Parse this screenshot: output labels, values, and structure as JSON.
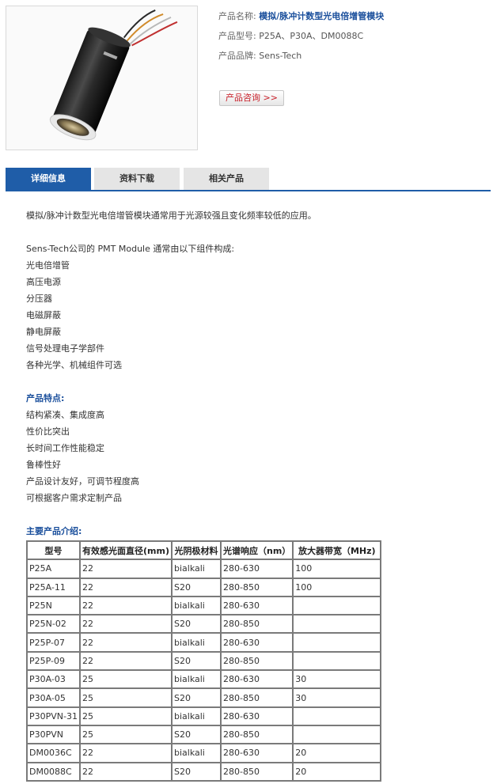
{
  "product": {
    "name_label": "产品名称:",
    "name_value": "模拟/脉冲计数型光电倍增管模块",
    "model_label": "产品型号:",
    "model_value": "P25A、P30A、DM0088C",
    "brand_label": "产品品牌:",
    "brand_value": "Sens-Tech",
    "consult_button": "产品咨询 >>"
  },
  "tabs": [
    {
      "label": "详细信息",
      "active": true
    },
    {
      "label": "资料下载",
      "active": false
    },
    {
      "label": "相关产品",
      "active": false
    }
  ],
  "content": {
    "intro": "模拟/脉冲计数型光电倍增管模块通常用于光源较强且变化频率较低的应用。",
    "components_intro": "Sens-Tech公司的 PMT Module 通常由以下组件构成:",
    "components": [
      " 光电倍增管",
      " 高压电源",
      " 分压器",
      " 电磁屏蔽",
      " 静电屏蔽",
      " 信号处理电子学部件",
      " 各种光学、机械组件可选"
    ],
    "features_heading": "产品特点:",
    "features": [
      "结构紧凑、集成度高",
      "性价比突出",
      "长时间工作性能稳定",
      "鲁棒性好",
      "产品设计友好，可调节程度高",
      "可根据客户需求定制产品"
    ],
    "table_heading": "主要产品介绍:"
  },
  "table": {
    "headers": [
      "型号",
      "有效感光面直径(mm)",
      "光阴极材料",
      "光谱响应（nm）",
      "放大器带宽（MHz)"
    ],
    "rows": [
      [
        "P25A",
        "22",
        "bialkali",
        "280-630",
        "100"
      ],
      [
        "P25A-11",
        "22",
        "S20",
        "280-850",
        "100"
      ],
      [
        "P25N",
        "22",
        "bialkali",
        "280-630",
        ""
      ],
      [
        "P25N-02",
        "22",
        "S20",
        "280-850",
        ""
      ],
      [
        "P25P-07",
        "22",
        "bialkali",
        "280-630",
        ""
      ],
      [
        "P25P-09",
        "22",
        "S20",
        "280-850",
        ""
      ],
      [
        "P30A-03",
        "25",
        "bialkali",
        "280-630",
        "30"
      ],
      [
        "P30A-05",
        "25",
        "S20",
        "280-850",
        "30"
      ],
      [
        "P30PVN-31",
        "25",
        "bialkali",
        "280-630",
        ""
      ],
      [
        "P30PVN",
        "25",
        "S20",
        "280-850",
        ""
      ],
      [
        "DM0036C",
        "22",
        "bialkali",
        "280-630",
        "20"
      ],
      [
        "DM0088C",
        "22",
        "S20",
        "280-850",
        "20"
      ]
    ]
  },
  "colors": {
    "accent_blue": "#1f5da8",
    "link_blue": "#1a4f9c",
    "button_red": "#c8202a"
  }
}
